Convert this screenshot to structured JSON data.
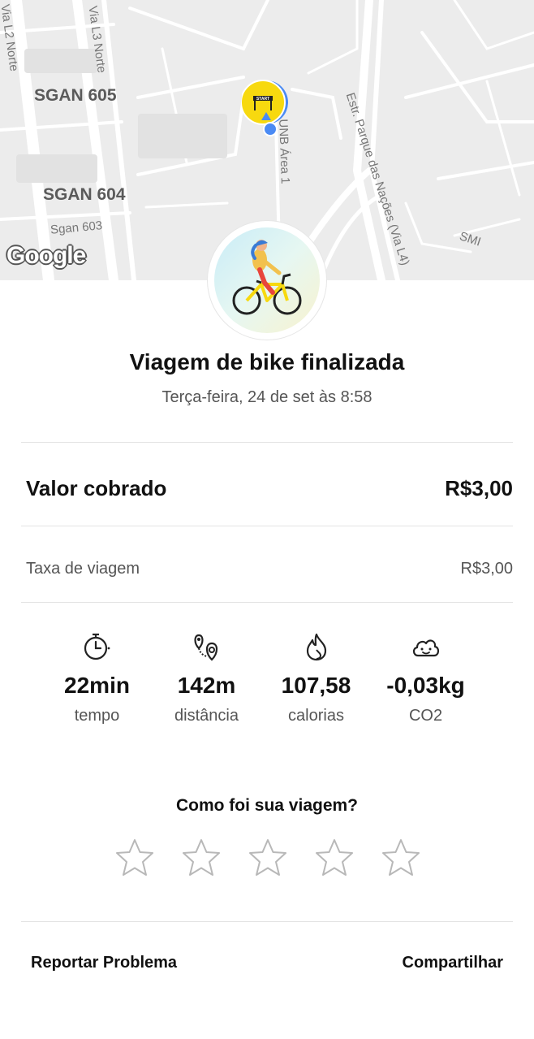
{
  "map": {
    "labels": {
      "sgan605": "SGAN 605",
      "sgan604": "SGAN 604",
      "sgan603": "Sgan 603",
      "via_l2": "Via L2 Norte",
      "via_l3": "Via L3 Norte",
      "unb": "UNB Área 1",
      "estrada": "Estr. Parque das Nações (Via L4)",
      "smi": "SMI"
    },
    "google_logo": "Google",
    "start_marker": "START"
  },
  "trip": {
    "title": "Viagem de bike finalizada",
    "datetime": "Terça-feira, 24 de set às 8:58"
  },
  "charges": {
    "total_label": "Valor cobrado",
    "total_value": "R$3,00",
    "fee_label": "Taxa de viagem",
    "fee_value": "R$3,00"
  },
  "stats": [
    {
      "icon": "stopwatch-icon",
      "value": "22min",
      "label": "tempo"
    },
    {
      "icon": "route-pin-icon",
      "value": "142m",
      "label": "distância"
    },
    {
      "icon": "flame-icon",
      "value": "107,58",
      "label": "calorias"
    },
    {
      "icon": "cloud-face-icon",
      "value": "-0,03kg",
      "label": "CO2"
    }
  ],
  "rating": {
    "question": "Como foi sua viagem?",
    "max_stars": 5,
    "selected": 0
  },
  "footer": {
    "report_label": "Reportar Problema",
    "share_label": "Compartilhar"
  },
  "colors": {
    "accent_yellow": "#f7d90f",
    "location_blue": "#4a8af4"
  }
}
